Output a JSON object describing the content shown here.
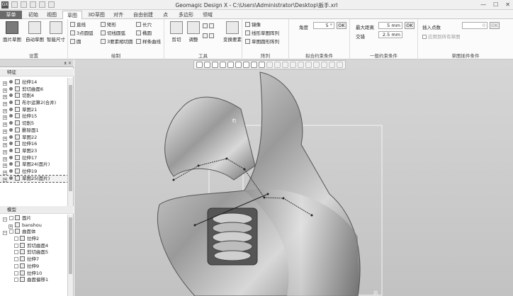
{
  "titlebar": {
    "app_icon": "GX",
    "title": "Geomagic Design X - C:\\Users\\Administrator\\Desktop\\扳手.xrl",
    "min": "—",
    "max": "☐",
    "close": "✕"
  },
  "tabs": [
    {
      "label": "草单"
    },
    {
      "label": "初始"
    },
    {
      "label": "视图"
    },
    {
      "label": "草图"
    },
    {
      "label": "3D草图"
    },
    {
      "label": "对齐"
    },
    {
      "label": "自由创建"
    },
    {
      "label": "点"
    },
    {
      "label": "多边形"
    },
    {
      "label": "领域"
    }
  ],
  "ribbon": {
    "set_group": {
      "label": "设置",
      "buttons": [
        {
          "label": "面片草图"
        },
        {
          "label": "自动草图"
        },
        {
          "label": "智能尺寸"
        }
      ]
    },
    "draw_group": {
      "label": "绘制",
      "items": [
        "直线",
        "3点圆弧",
        "圆",
        "矩形",
        "切线圆弧",
        "3要素相切圆",
        "长穴",
        "椭圆",
        "样条曲线"
      ]
    },
    "tools_group": {
      "label": "工具",
      "items": [
        "剪切",
        "调整",
        "变换要素"
      ]
    },
    "array_group": {
      "label": "阵列",
      "items": [
        "镜像",
        "线形草图阵列",
        "草图圆形阵列"
      ]
    },
    "fit_group": {
      "label": "拟合约束条件",
      "angle_label": "角度",
      "angle_value": "5 °",
      "ok": "OK"
    },
    "constraint_group": {
      "label": "一般约束条件",
      "max_dist_label": "最大距离",
      "max_dist_value": "5 mm",
      "intersect_label": "交错",
      "intersect_value": "2.5 mm",
      "ok": "OK"
    },
    "sketch_group": {
      "label": "草图插件条件",
      "insert_label": "插入点数",
      "insert_value": "0",
      "ok": "OK",
      "check_label": "应用到所有草图"
    }
  },
  "feature_panel": {
    "header": "特征",
    "items": [
      {
        "label": "拉伸14"
      },
      {
        "label": "剪切曲面6"
      },
      {
        "label": "切削4"
      },
      {
        "label": "布尔运算2(合并)"
      },
      {
        "label": "草图21"
      },
      {
        "label": "拉伸15"
      },
      {
        "label": "切削5"
      },
      {
        "label": "删除面1"
      },
      {
        "label": "草图22"
      },
      {
        "label": "拉伸16"
      },
      {
        "label": "草图23"
      },
      {
        "label": "拉伸17"
      },
      {
        "label": "草图24(面片)"
      },
      {
        "label": "拉伸19"
      },
      {
        "label": "草图25(面片)"
      }
    ]
  },
  "model_panel": {
    "header": "模型",
    "items": [
      {
        "label": "面片"
      },
      {
        "label": "banshou"
      },
      {
        "label": "曲面体"
      },
      {
        "label": "拉伸2"
      },
      {
        "label": "剪切曲面4"
      },
      {
        "label": "剪切曲面5"
      },
      {
        "label": "拉伸7"
      },
      {
        "label": "拉伸9"
      },
      {
        "label": "拉伸10"
      },
      {
        "label": "曲面偏移1"
      }
    ]
  },
  "viewport": {
    "label_top": "右",
    "label_bottom": "前"
  }
}
